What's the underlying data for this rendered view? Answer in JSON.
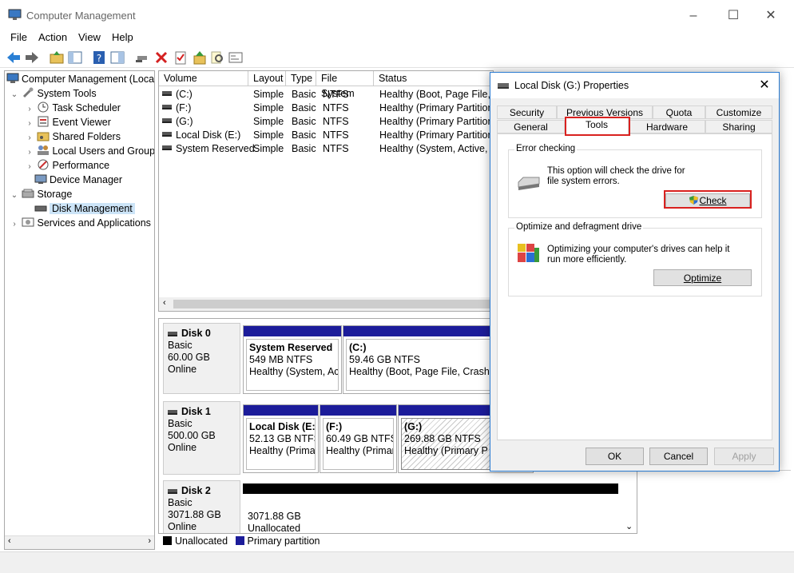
{
  "window": {
    "title": "Computer Management"
  },
  "menu": [
    "File",
    "Action",
    "View",
    "Help"
  ],
  "tree": [
    {
      "label": "Computer Management (Local",
      "arrow": "",
      "level": 0,
      "icon": "computer-icon"
    },
    {
      "label": "System Tools",
      "arrow": "⌄",
      "level": 1,
      "icon": "tools-icon"
    },
    {
      "label": "Task Scheduler",
      "arrow": "›",
      "level": 2,
      "icon": "clock-icon"
    },
    {
      "label": "Event Viewer",
      "arrow": "›",
      "level": 2,
      "icon": "event-icon"
    },
    {
      "label": "Shared Folders",
      "arrow": "›",
      "level": 2,
      "icon": "folder-share-icon"
    },
    {
      "label": "Local Users and Groups",
      "arrow": "›",
      "level": 2,
      "icon": "users-icon"
    },
    {
      "label": "Performance",
      "arrow": "›",
      "level": 2,
      "icon": "performance-icon"
    },
    {
      "label": "Device Manager",
      "arrow": "",
      "level": 2,
      "icon": "device-manager-icon"
    },
    {
      "label": "Storage",
      "arrow": "⌄",
      "level": 1,
      "icon": "storage-icon"
    },
    {
      "label": "Disk Management",
      "arrow": "",
      "level": 2,
      "icon": "disk-icon",
      "selected": true
    },
    {
      "label": "Services and Applications",
      "arrow": "›",
      "level": 1,
      "icon": "services-icon"
    }
  ],
  "volume_table": {
    "headers": [
      "Volume",
      "Layout",
      "Type",
      "File System",
      "Status"
    ],
    "rows": [
      [
        "(C:)",
        "Simple",
        "Basic",
        "NTFS",
        "Healthy (Boot, Page File, C"
      ],
      [
        "(F:)",
        "Simple",
        "Basic",
        "NTFS",
        "Healthy (Primary Partition"
      ],
      [
        "(G:)",
        "Simple",
        "Basic",
        "NTFS",
        "Healthy (Primary Partition"
      ],
      [
        "Local Disk (E:)",
        "Simple",
        "Basic",
        "NTFS",
        "Healthy (Primary Partition"
      ],
      [
        "System Reserved",
        "Simple",
        "Basic",
        "NTFS",
        "Healthy (System, Active, P"
      ]
    ]
  },
  "disks": [
    {
      "name": "Disk 0",
      "type": "Basic",
      "size": "60.00 GB",
      "status": "Online",
      "partitions": [
        {
          "name": "System Reserved",
          "size": "549 MB NTFS",
          "status": "Healthy (System, Act"
        },
        {
          "name": "(C:)",
          "size": "59.46 GB NTFS",
          "status": "Healthy (Boot, Page File, Crash Du"
        }
      ]
    },
    {
      "name": "Disk 1",
      "type": "Basic",
      "size": "500.00 GB",
      "status": "Online",
      "partitions": [
        {
          "name": "Local Disk  (E:)",
          "size": "52.13 GB NTFS",
          "status": "Healthy (Primar"
        },
        {
          "name": "(F:)",
          "size": "60.49 GB NTFS",
          "status": "Healthy (Primar"
        },
        {
          "name": "(G:)",
          "size": "269.88 GB NTFS",
          "status": "Healthy (Primary P"
        }
      ]
    },
    {
      "name": "Disk 2",
      "type": "Basic",
      "size": "3071.88 GB",
      "status": "Online",
      "partitions": [
        {
          "name": "",
          "size": "3071.88 GB",
          "status": "Unallocated"
        }
      ]
    }
  ],
  "legend": [
    {
      "label": "Unallocated",
      "color": "#000000"
    },
    {
      "label": "Primary partition",
      "color": "#1c1c9a"
    }
  ],
  "dialog": {
    "title": "Local Disk (G:) Properties",
    "tabs_row1": [
      "Security",
      "Previous Versions",
      "Quota",
      "Customize"
    ],
    "tabs_row2": [
      "General",
      "Tools",
      "Hardware",
      "Sharing"
    ],
    "active_tab": "Tools",
    "error_checking": {
      "title": "Error checking",
      "text": "This option will check the drive for file system errors.",
      "button": "Check"
    },
    "optimize": {
      "title": "Optimize and defragment drive",
      "text": "Optimizing your computer's drives can help it run more efficiently.",
      "button": "Optimize"
    },
    "buttons": {
      "ok": "OK",
      "cancel": "Cancel",
      "apply": "Apply"
    }
  },
  "colors": {
    "primary_partition": "#1c1c9a",
    "highlight_box": "#d9211f",
    "selection": "#cce4f7"
  }
}
